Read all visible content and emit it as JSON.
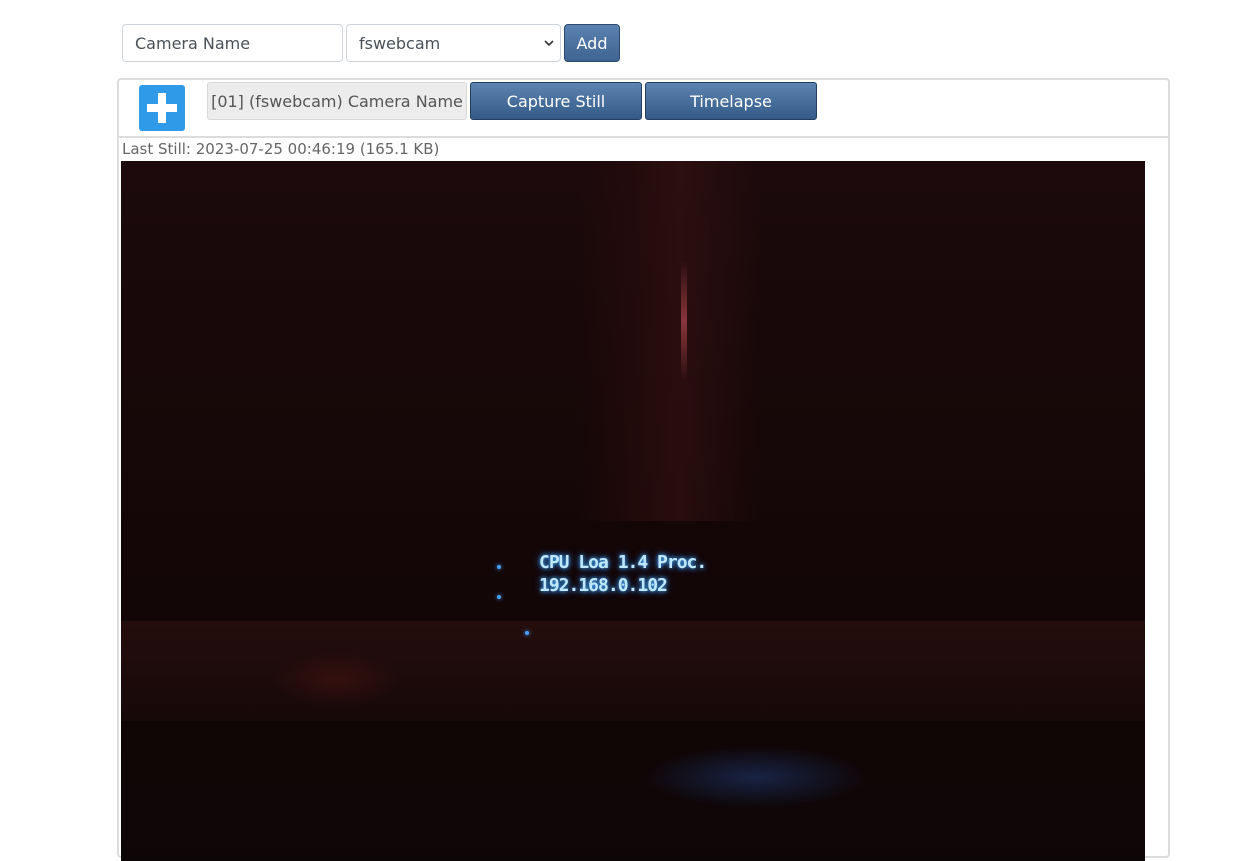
{
  "add_camera": {
    "name_placeholder": "Camera Name",
    "type_value": "fswebcam",
    "add_label": "Add"
  },
  "camera": {
    "label": "[01] (fswebcam) Camera Name",
    "capture_label": "Capture Still",
    "timelapse_label": "Timelapse",
    "last_still": "Last Still: 2023-07-25 00:46:19 (165.1 KB)",
    "image_text_line1": "CPU Loa 1.4 Proc.",
    "image_text_line2": "192.168.0.102"
  },
  "icons": {
    "expand": "plus-icon",
    "dropdown": "chevron-down-icon"
  },
  "colors": {
    "button_primary": "#3f6492",
    "plus_button": "#2f9be8",
    "label_bg": "#ececec"
  }
}
